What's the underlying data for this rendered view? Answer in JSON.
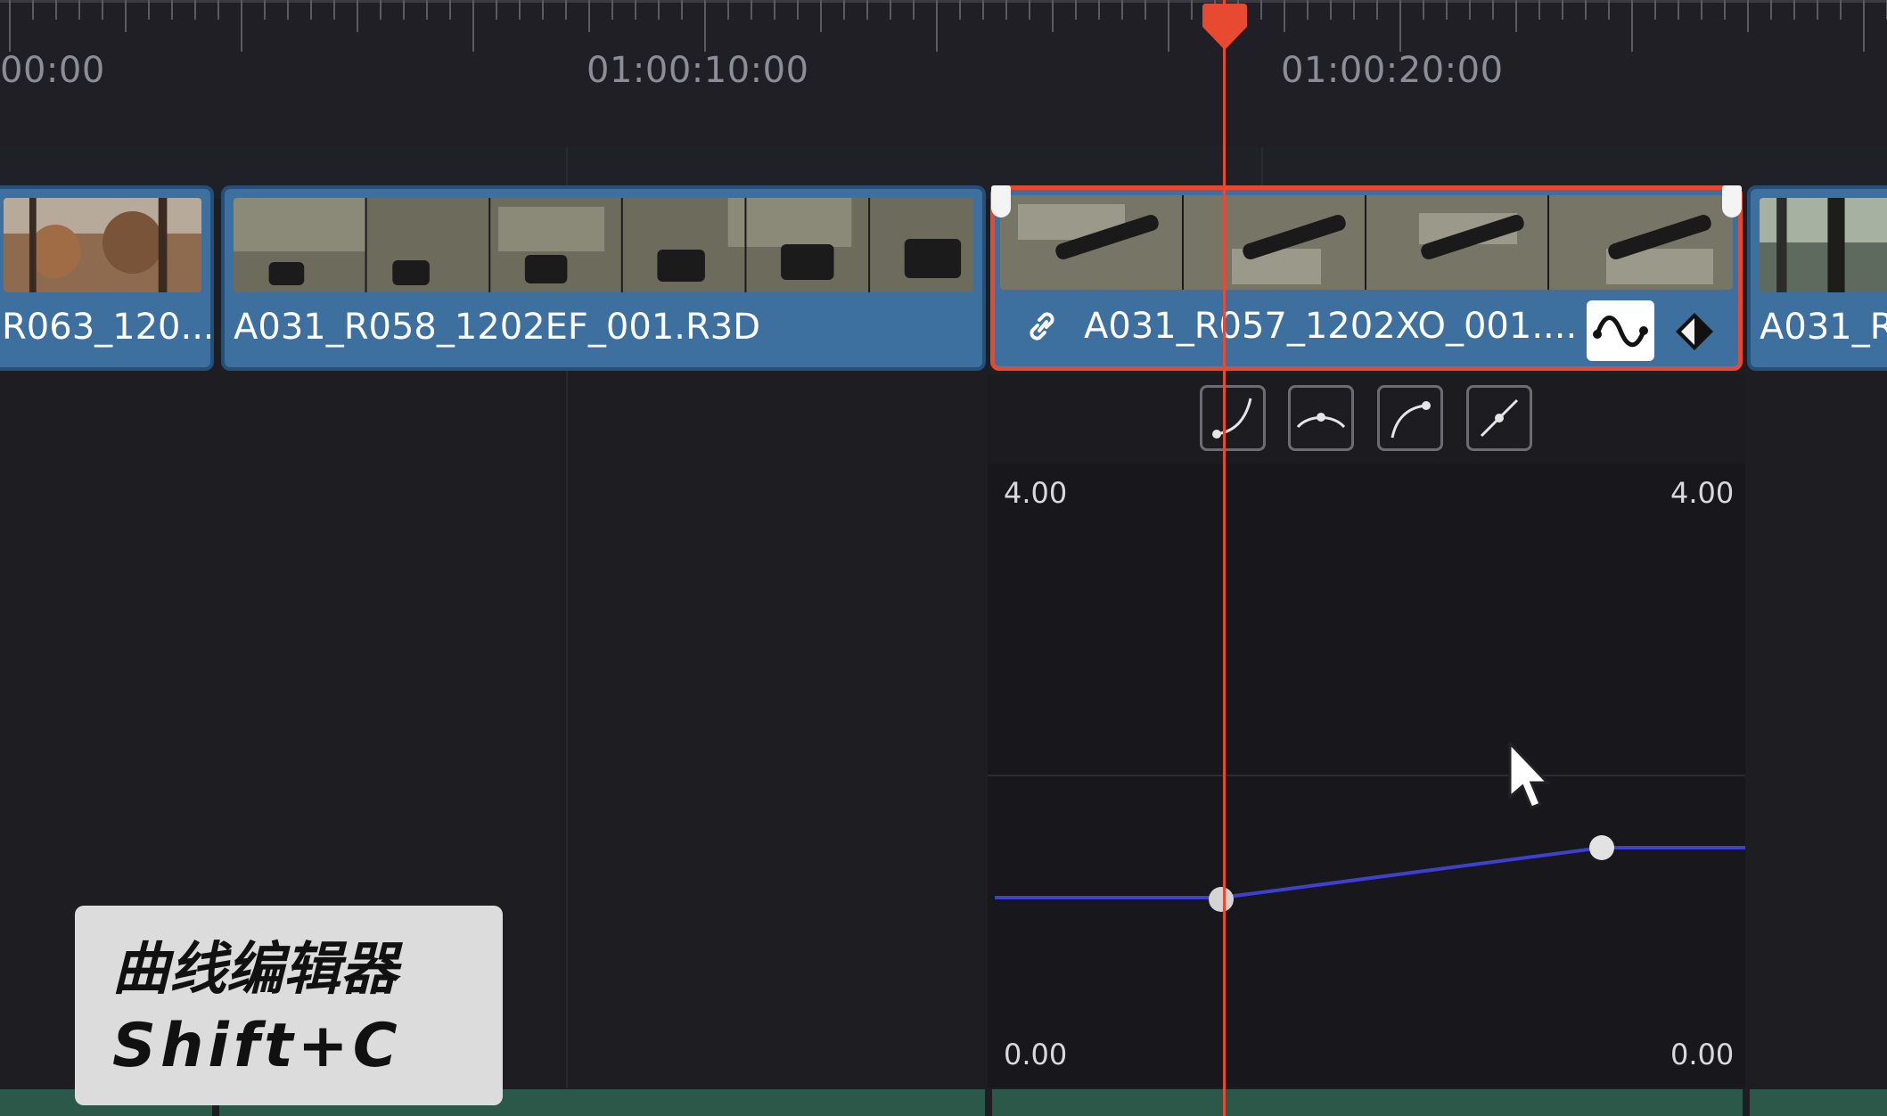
{
  "ruler": {
    "timecodes": [
      "00:00",
      "01:00:10:00",
      "01:00:20:00"
    ]
  },
  "clips": [
    {
      "name": "R063_120..."
    },
    {
      "name": "A031_R058_1202EF_001.R3D"
    },
    {
      "name": "A031_R057_1202XO_001...."
    },
    {
      "name": "A031_R"
    }
  ],
  "curve_editor": {
    "y_max_left": "4.00",
    "y_max_right": "4.00",
    "y_min_left": "0.00",
    "y_min_right": "0.00",
    "tools": [
      "ease-in-icon",
      "ease-in-out-icon",
      "ease-out-icon",
      "linear-icon"
    ]
  },
  "overlay": {
    "title": "曲线编辑器",
    "shortcut": "Shift+C"
  },
  "colors": {
    "selection": "#e6492f",
    "clip": "#3d6f9f",
    "curve": "#3f3fd0",
    "audio_track": "#2b5848"
  }
}
